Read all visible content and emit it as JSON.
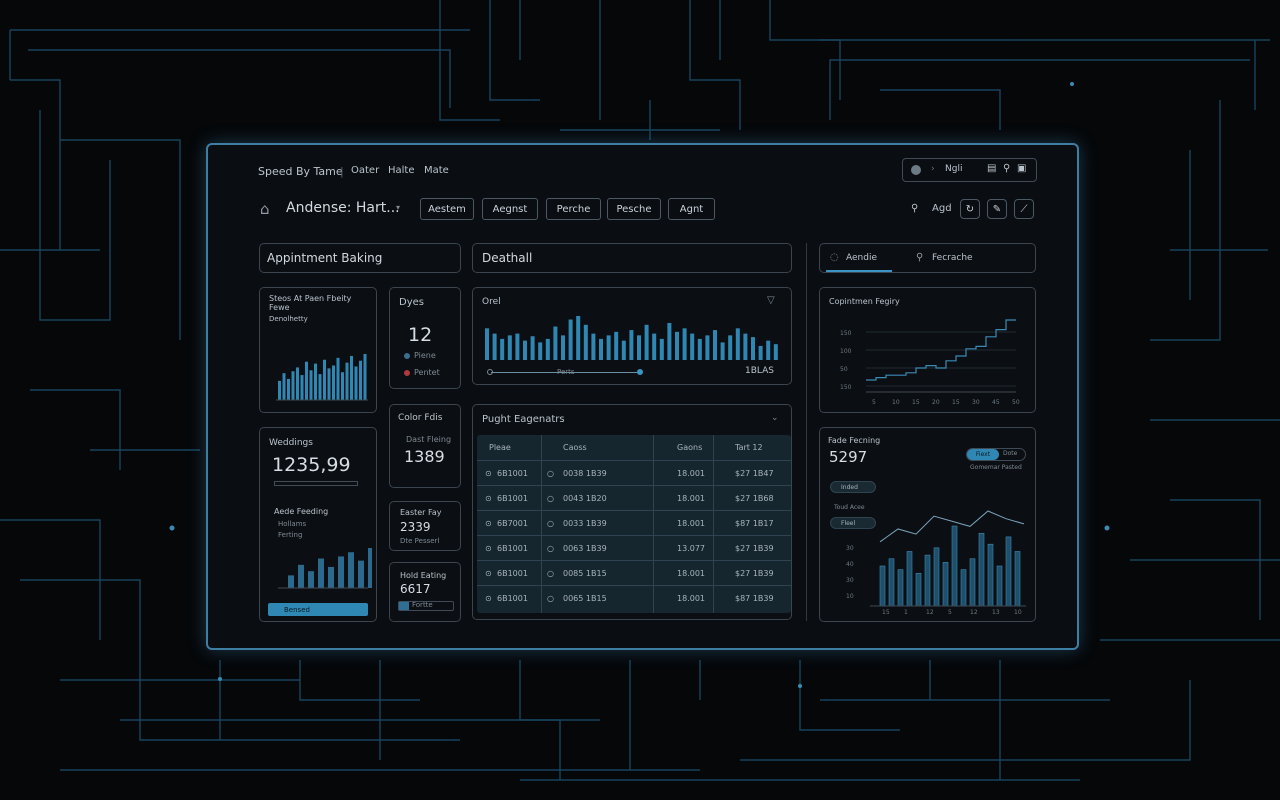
{
  "window": {
    "title": "Speed By Tame",
    "menu": [
      "Oater",
      "Halte",
      "Mate"
    ],
    "app_name": "Andense: Hart...",
    "top_toolbar_text": "Ngli",
    "nav_buttons": [
      "Aestem",
      "Aegnst",
      "Perche",
      "Pesche",
      "Agnt"
    ],
    "right_label": "Agd"
  },
  "left_header": "Appintment Baking",
  "center_header": "Deathall",
  "right_tabs": [
    "Aendie",
    "Fecrache"
  ],
  "card_sales": {
    "title": "Steos At Paen Fbeity",
    "subtitle": "Fewe",
    "sub2": "Denolhetty",
    "bars": [
      20,
      28,
      22,
      30,
      34,
      26,
      40,
      31,
      38,
      27,
      42,
      33,
      36,
      44,
      29,
      39,
      46,
      35,
      41,
      48
    ]
  },
  "card_dyes": {
    "title": "Dyes",
    "value": "12",
    "line1": "Piene",
    "line2": "Pentet"
  },
  "card_weddings": {
    "title": "Weddings",
    "value": "1235,99",
    "sub": "Aede Feeding",
    "sub2": "Hollams",
    "sub3": "Ferting",
    "bars": [
      12,
      22,
      16,
      28,
      20,
      30,
      34,
      26,
      38
    ],
    "button": "Bensed"
  },
  "card_color": {
    "title": "Color Fdis",
    "sub": "Dast Fleing",
    "value": "1389"
  },
  "card_easter": {
    "title": "Easter Fay",
    "value": "2339",
    "sub": "Dte Pesserl"
  },
  "card_hold": {
    "title": "Hold Eating",
    "value": "6617",
    "sub": "Fortte"
  },
  "card_orel": {
    "title": "Orel",
    "footer_left": "Perts",
    "footer_right": "1BLAS",
    "bars": [
      36,
      30,
      24,
      28,
      30,
      22,
      27,
      20,
      24,
      38,
      28,
      46,
      50,
      40,
      30,
      24,
      28,
      32,
      22,
      34,
      28,
      40,
      30,
      24,
      42,
      32,
      36,
      30,
      24,
      28,
      34,
      20,
      28,
      36,
      30,
      26,
      16,
      22,
      18
    ]
  },
  "card_pages": {
    "title": "Pught Eagenatrs",
    "columns": [
      "Pleae",
      "Caoss",
      "Gaons",
      "Tart 12"
    ],
    "rows": [
      [
        "6B1001",
        "0038 1B39",
        "18.001",
        "$27 1B47"
      ],
      [
        "6B1001",
        "0043 1B20",
        "18.001",
        "$27 1B68"
      ],
      [
        "6B7001",
        "0033 1B39",
        "18.001",
        "$87 1B17"
      ],
      [
        "6B1001",
        "0063 1B39",
        "13.077",
        "$27 1B39"
      ],
      [
        "6B1001",
        "0085 1B15",
        "18.001",
        "$27 1B39"
      ],
      [
        "6B1001",
        "0065 1B15",
        "18.001",
        "$87 1B39"
      ]
    ]
  },
  "card_capacity": {
    "title": "Copintmen Fegiry",
    "y_ticks": [
      "150",
      "100",
      "50",
      "150"
    ],
    "x_ticks": [
      "5",
      "10",
      "15",
      "20",
      "15",
      "30",
      "45",
      "50"
    ],
    "steps": [
      10,
      12,
      14,
      14,
      16,
      20,
      22,
      20,
      26,
      30,
      36,
      38,
      46,
      52,
      60
    ]
  },
  "card_total": {
    "title": "Fade Fecning",
    "value": "5297",
    "toggle": [
      "Fiext",
      "Dote"
    ],
    "caption": "Gomemar Pasted",
    "pill1": "Inded",
    "pill2": "Toud Acee",
    "pill3": "Fleel",
    "bars": [
      22,
      26,
      20,
      30,
      18,
      28,
      32,
      24,
      44,
      20,
      26,
      40,
      34,
      22,
      38,
      30
    ],
    "line": [
      50,
      60,
      56,
      70,
      66,
      62,
      74,
      68,
      64
    ],
    "y_ticks": [
      "30",
      "40",
      "30",
      "10"
    ],
    "x_ticks": [
      "15",
      "1",
      "12",
      "5",
      "12",
      "13",
      "10"
    ]
  },
  "colors": {
    "accent": "#3a95c4",
    "bar": "#2f88b4",
    "border": "#3a4550"
  }
}
